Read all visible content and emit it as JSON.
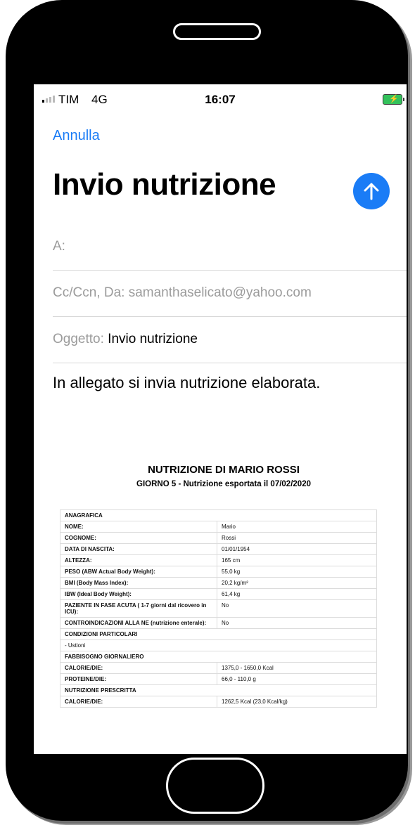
{
  "status_bar": {
    "carrier": "TIM",
    "network": "4G",
    "time": "16:07"
  },
  "mail": {
    "cancel_label": "Annulla",
    "title": "Invio nutrizione",
    "to_label": "A:",
    "cc_label": "Cc/Ccn, Da:",
    "cc_value": "samanthaselicato@yahoo.com",
    "subject_label": "Oggetto:",
    "subject_value": "Invio nutrizione",
    "body": "In allegato si invia nutrizione elaborata."
  },
  "attachment": {
    "title": "NUTRIZIONE DI MARIO ROSSI",
    "subtitle": "GIORNO 5 - Nutrizione esportata il 07/02/2020",
    "rows": [
      {
        "type": "section",
        "label": "ANAGRAFICA"
      },
      {
        "type": "kv",
        "label": "NOME:",
        "value": "Mario"
      },
      {
        "type": "kv",
        "label": "COGNOME:",
        "value": "Rossi"
      },
      {
        "type": "kv",
        "label": "DATA DI NASCITA:",
        "value": "01/01/1954"
      },
      {
        "type": "kv",
        "label": "ALTEZZA:",
        "value": "165 cm"
      },
      {
        "type": "kv",
        "label": "PESO (ABW Actual Body Weight):",
        "value": "55,0 kg"
      },
      {
        "type": "kv",
        "label": "BMI (Body Mass Index):",
        "value": "20,2 kg/m²"
      },
      {
        "type": "kv",
        "label": "IBW (Ideal Body Weight):",
        "value": "61,4 kg"
      },
      {
        "type": "kv",
        "label": "PAZIENTE IN FASE ACUTA ( 1-7 giorni dal ricovero in ICU):",
        "value": "No"
      },
      {
        "type": "kv",
        "label": "CONTROINDICAZIONI ALLA NE (nutrizione enterale):",
        "value": "No"
      },
      {
        "type": "section",
        "label": "CONDIZIONI PARTICOLARI"
      },
      {
        "type": "text",
        "label": "- Ustioni"
      },
      {
        "type": "section",
        "label": "FABBISOGNO GIORNALIERO"
      },
      {
        "type": "kv",
        "label": "CALORIE/DIE:",
        "value": "1375,0 - 1650,0 Kcal"
      },
      {
        "type": "kv",
        "label": "PROTEINE/DIE:",
        "value": "66,0 - 110,0 g"
      },
      {
        "type": "section",
        "label": "NUTRIZIONE PRESCRITTA"
      },
      {
        "type": "kv",
        "label": "CALORIE/DIE:",
        "value": "1262,5 Kcal (23,0 Kcal/kg)"
      }
    ]
  }
}
